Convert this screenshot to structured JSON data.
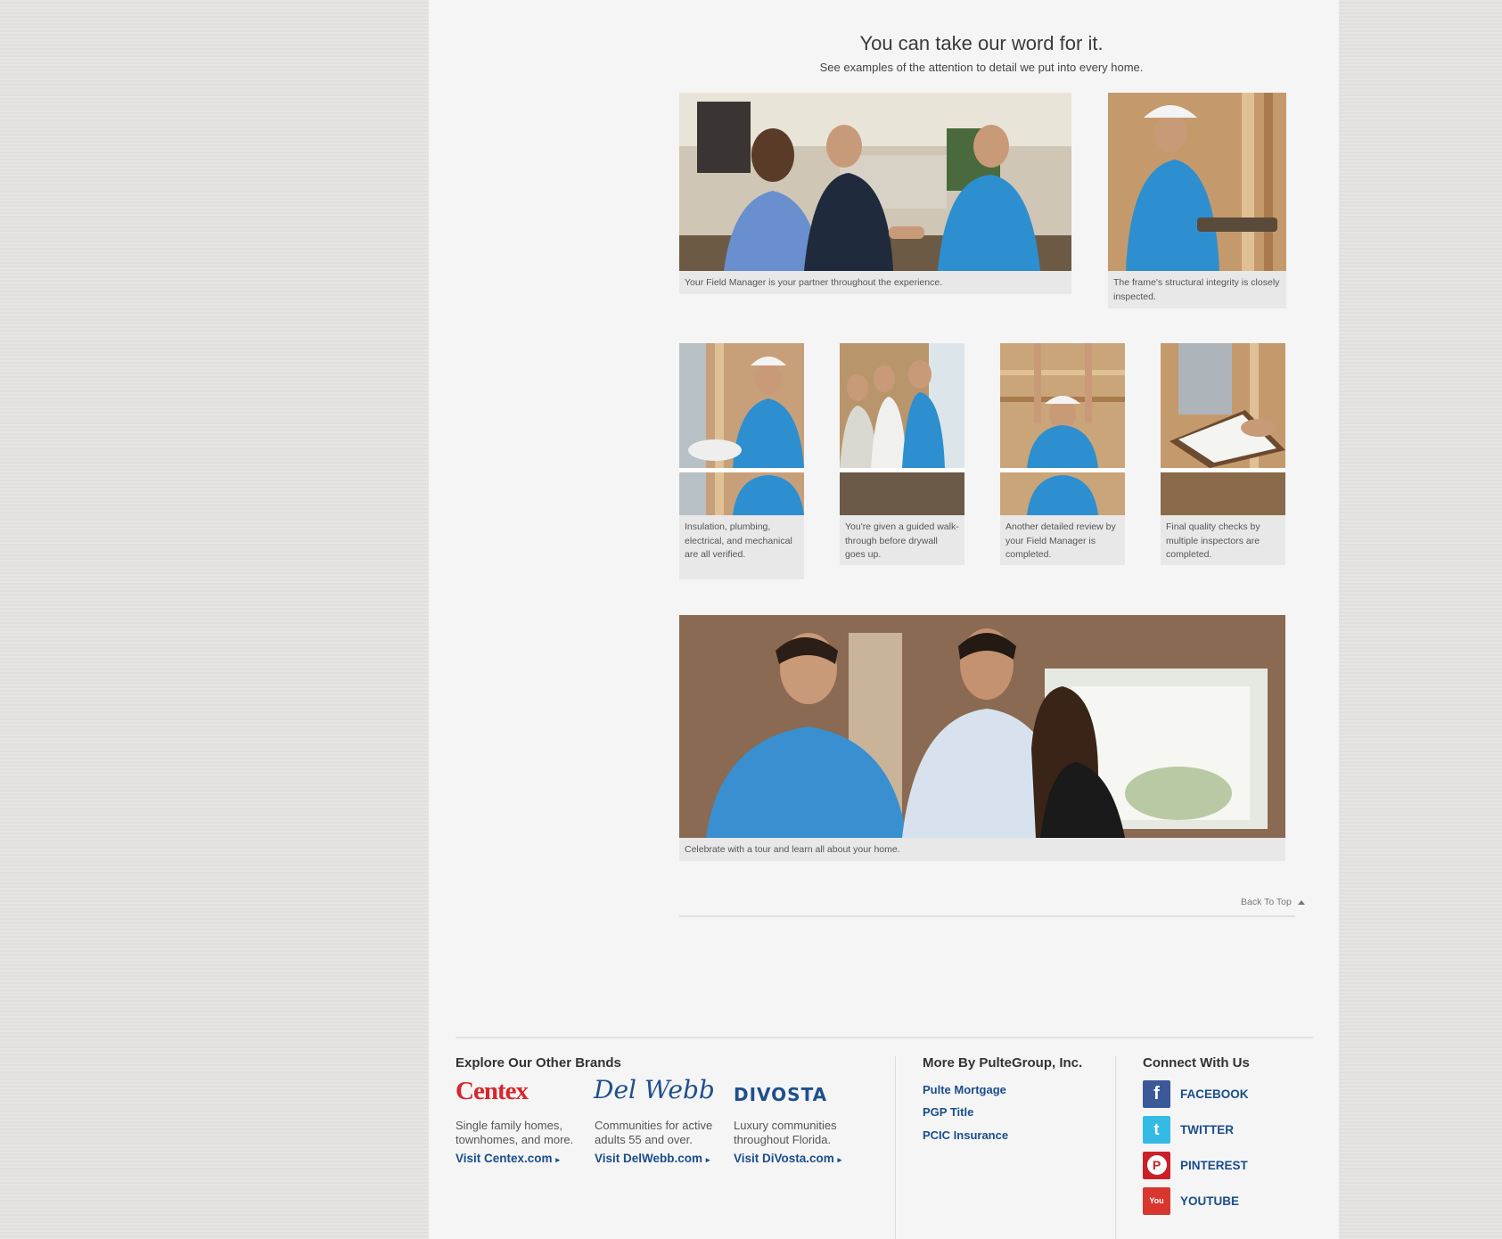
{
  "heading": "You can take our word for it.",
  "subheading": "See examples of the attention to detail we put into every home.",
  "photos": {
    "p1": "Your Field Manager is your partner throughout the experience.",
    "p2": "The frame's structural integrity is closely inspected.",
    "p3": "Insulation, plumbing, electrical, and mechanical are all verified.",
    "p4": "You're given a guided walk-through before drywall goes up.",
    "p5": "Another detailed review by your Field Manager is completed.",
    "p6": "Final quality checks by multiple inspectors are completed.",
    "p7": "Celebrate with a tour and learn all about your home."
  },
  "back_to_top": "Back To Top",
  "footer": {
    "brands_title": "Explore Our Other Brands",
    "brands": [
      {
        "logo": "Centex",
        "desc": "Single family homes, townhomes, and more.",
        "link": "Visit Centex.com"
      },
      {
        "logo": "Del Webb",
        "desc": "Communities for active adults 55 and over.",
        "link": "Visit DelWebb.com"
      },
      {
        "logo": "DIVOSTA",
        "desc": "Luxury communities throughout Florida.",
        "link": "Visit DiVosta.com"
      }
    ],
    "more_title": "More By PulteGroup, Inc.",
    "more_links": [
      "Pulte Mortgage",
      "PGP Title",
      "PCIC Insurance"
    ],
    "connect_title": "Connect With Us",
    "social": [
      {
        "label": "FACEBOOK",
        "icon": "facebook-icon",
        "color": "#3b5998",
        "glyph": "f"
      },
      {
        "label": "TWITTER",
        "icon": "twitter-icon",
        "color": "#33bbe6",
        "glyph": "t"
      },
      {
        "label": "PINTEREST",
        "icon": "pinterest-icon",
        "color": "#cb2027",
        "glyph": "P"
      },
      {
        "label": "YOUTUBE",
        "icon": "youtube-icon",
        "color": "#d8362f",
        "glyph": "You"
      }
    ]
  }
}
